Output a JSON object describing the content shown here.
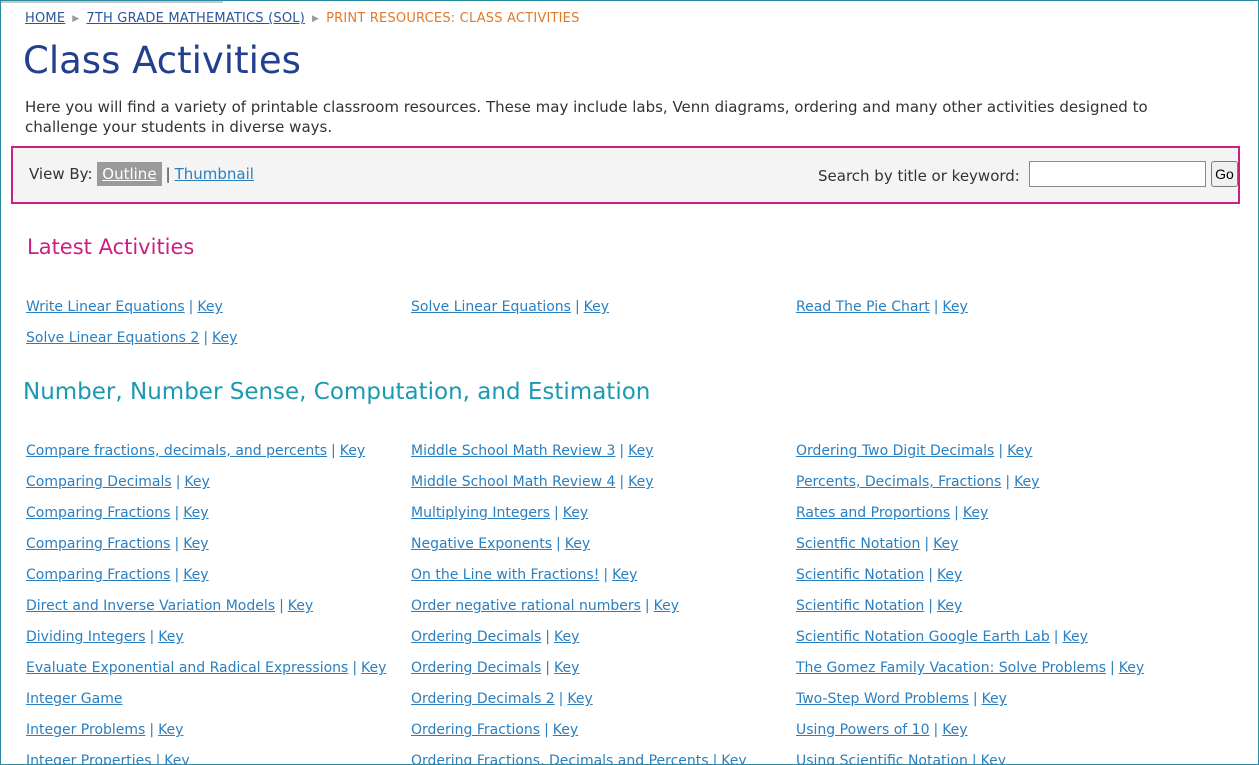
{
  "breadcrumb": {
    "home": "HOME",
    "course": "7TH GRADE MATHEMATICS (SOL)",
    "current": "PRINT RESOURCES: CLASS ACTIVITIES"
  },
  "page": {
    "title": "Class Activities",
    "intro": "Here you will find a variety of printable classroom resources. These may include labs, Venn diagrams, ordering and many other activities designed to challenge your students in diverse ways."
  },
  "viewbar": {
    "label": "View By:",
    "outline": "Outline",
    "separator": "|",
    "thumbnail": "Thumbnail",
    "search_label": "Search by title or keyword:",
    "search_value": "",
    "go_label": "Go"
  },
  "colors": {
    "accent_magenta": "#cc1f82",
    "accent_teal": "#1a9ab0",
    "title_blue": "#23408e",
    "link_blue": "#2a7fc0",
    "breadcrumb_orange": "#e07a2a"
  },
  "latest": {
    "title": "Latest Activities",
    "columns": [
      [
        {
          "title": "Write Linear Equations",
          "key": "Key"
        },
        {
          "title": "Solve Linear Equations 2",
          "key": "Key"
        }
      ],
      [
        {
          "title": "Solve Linear Equations",
          "key": "Key"
        }
      ],
      [
        {
          "title": "Read The Pie Chart",
          "key": "Key"
        }
      ]
    ]
  },
  "number_sense": {
    "title": "Number, Number Sense, Computation, and Estimation",
    "columns": [
      [
        {
          "title": "Compare fractions, decimals, and percents",
          "key": "Key"
        },
        {
          "title": "Comparing Decimals",
          "key": "Key"
        },
        {
          "title": "Comparing Fractions",
          "key": "Key"
        },
        {
          "title": "Comparing Fractions",
          "key": "Key"
        },
        {
          "title": "Comparing Fractions",
          "key": "Key"
        },
        {
          "title": "Direct and Inverse Variation Models",
          "key": "Key"
        },
        {
          "title": "Dividing Integers",
          "key": "Key"
        },
        {
          "title": "Evaluate Exponential and Radical Expressions",
          "key": "Key"
        },
        {
          "title": "Integer Game",
          "key": ""
        },
        {
          "title": "Integer Problems",
          "key": "Key"
        },
        {
          "title": "Integer Properties",
          "key": "Key"
        }
      ],
      [
        {
          "title": "Middle School Math Review 3",
          "key": "Key"
        },
        {
          "title": "Middle School Math Review 4",
          "key": "Key"
        },
        {
          "title": "Multiplying Integers",
          "key": "Key"
        },
        {
          "title": "Negative Exponents",
          "key": "Key"
        },
        {
          "title": "On the Line with Fractions!",
          "key": "Key"
        },
        {
          "title": "Order negative rational numbers",
          "key": "Key"
        },
        {
          "title": "Ordering Decimals",
          "key": "Key"
        },
        {
          "title": "Ordering Decimals",
          "key": "Key"
        },
        {
          "title": "Ordering Decimals 2",
          "key": "Key"
        },
        {
          "title": "Ordering Fractions",
          "key": "Key"
        },
        {
          "title": "Ordering Fractions, Decimals and Percents",
          "key": "Key"
        }
      ],
      [
        {
          "title": "Ordering Two Digit Decimals",
          "key": "Key"
        },
        {
          "title": "Percents, Decimals, Fractions",
          "key": "Key"
        },
        {
          "title": "Rates and Proportions",
          "key": "Key"
        },
        {
          "title": "Scientfic Notation",
          "key": "Key"
        },
        {
          "title": "Scientific Notation",
          "key": "Key"
        },
        {
          "title": "Scientific Notation",
          "key": "Key"
        },
        {
          "title": "Scientific Notation Google Earth Lab",
          "key": "Key"
        },
        {
          "title": "The Gomez Family Vacation: Solve Problems",
          "key": "Key"
        },
        {
          "title": "Two-Step Word Problems",
          "key": "Key"
        },
        {
          "title": "Using Powers of 10",
          "key": "Key"
        },
        {
          "title": "Using Scientific Notation",
          "key": "Key"
        }
      ]
    ]
  }
}
